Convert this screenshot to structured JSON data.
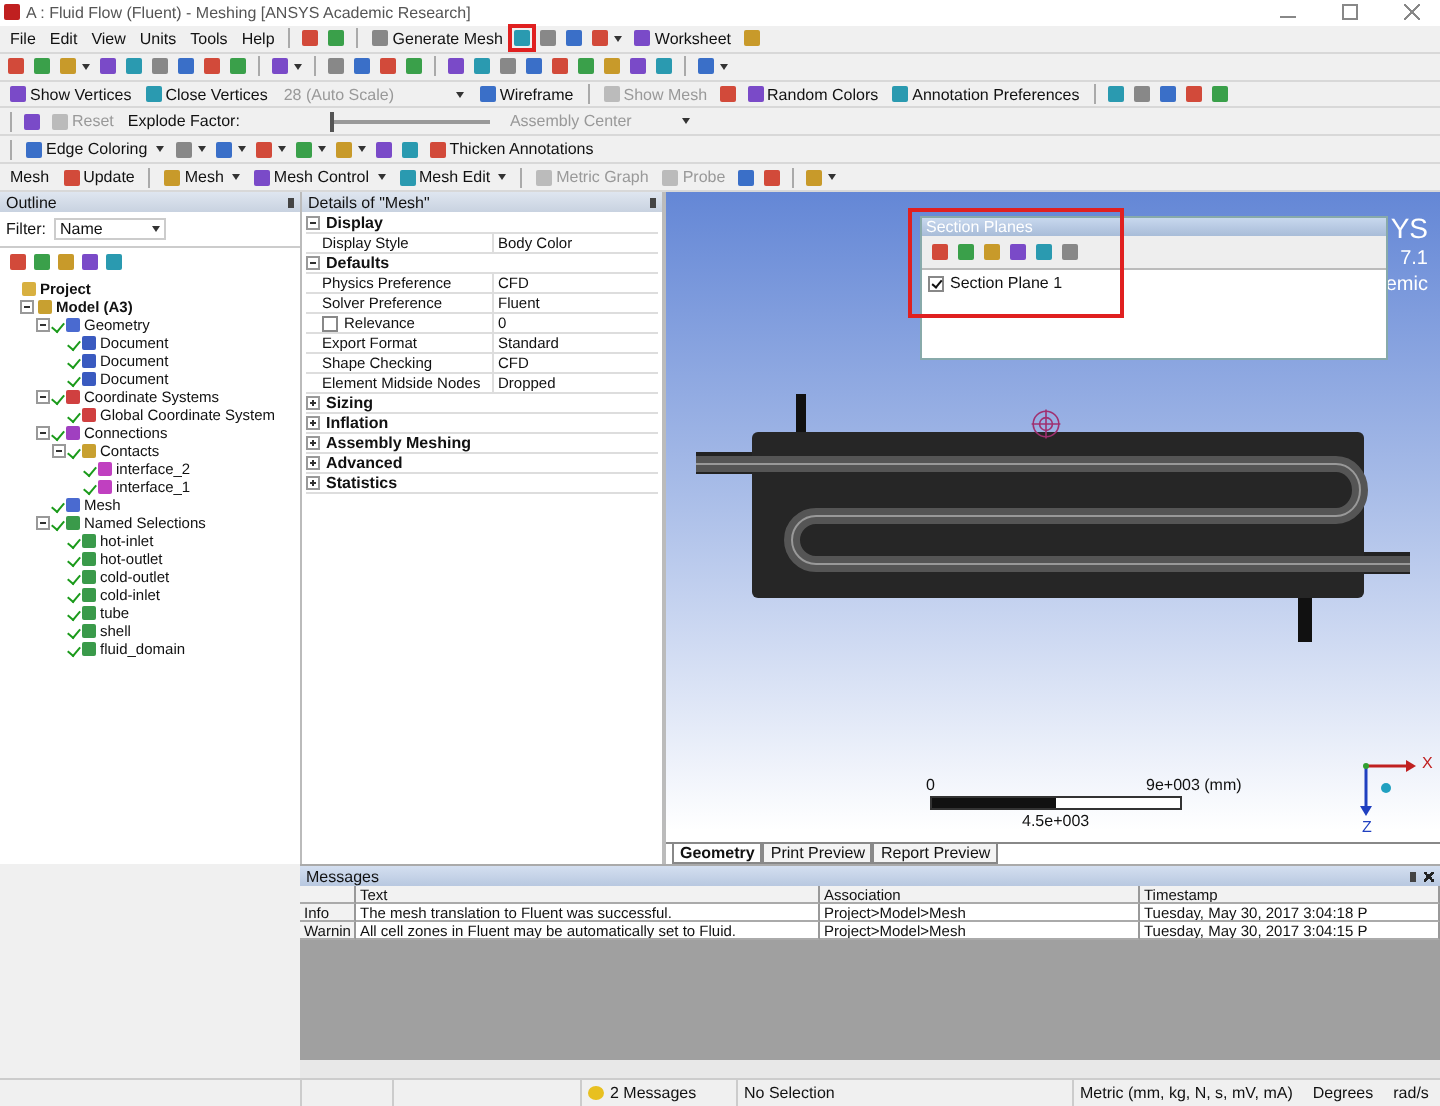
{
  "window": {
    "title": "A : Fluid Flow (Fluent) - Meshing [ANSYS Academic Research]"
  },
  "menu": [
    "File",
    "Edit",
    "View",
    "Units",
    "Tools",
    "Help"
  ],
  "toolbars": [
    {
      "items": [
        {
          "kind": "sep"
        },
        {
          "kind": "icon",
          "caret": false,
          "highlighted": false
        },
        {
          "kind": "icon",
          "caret": false,
          "highlighted": false
        },
        {
          "kind": "sep"
        },
        {
          "kind": "button",
          "label": "Generate Mesh",
          "caret": false,
          "disabled": false
        },
        {
          "kind": "icon",
          "caret": false,
          "highlighted": true
        },
        {
          "kind": "icon",
          "caret": false,
          "highlighted": false
        },
        {
          "kind": "icon",
          "caret": false,
          "highlighted": false
        },
        {
          "kind": "icon",
          "caret": true,
          "highlighted": false
        },
        {
          "kind": "button",
          "label": "Worksheet",
          "caret": false,
          "disabled": false
        },
        {
          "kind": "icon",
          "caret": false,
          "highlighted": false
        }
      ]
    },
    {
      "items": [
        {
          "kind": "icon",
          "caret": false,
          "highlighted": false
        },
        {
          "kind": "icon",
          "caret": false,
          "highlighted": false
        },
        {
          "kind": "icon",
          "caret": true,
          "highlighted": false
        },
        {
          "kind": "icon",
          "caret": false,
          "highlighted": false
        },
        {
          "kind": "icon",
          "caret": false,
          "highlighted": false
        },
        {
          "kind": "icon",
          "caret": false,
          "highlighted": false
        },
        {
          "kind": "icon",
          "caret": false,
          "highlighted": false
        },
        {
          "kind": "icon",
          "caret": false,
          "highlighted": false
        },
        {
          "kind": "icon",
          "caret": false,
          "highlighted": false
        },
        {
          "kind": "sep"
        },
        {
          "kind": "icon",
          "caret": true,
          "highlighted": false
        },
        {
          "kind": "sep"
        },
        {
          "kind": "icon",
          "caret": false,
          "highlighted": false
        },
        {
          "kind": "icon",
          "caret": false,
          "highlighted": false
        },
        {
          "kind": "icon",
          "caret": false,
          "highlighted": false
        },
        {
          "kind": "icon",
          "caret": false,
          "highlighted": false
        },
        {
          "kind": "sep"
        },
        {
          "kind": "icon",
          "caret": false,
          "highlighted": false
        },
        {
          "kind": "icon",
          "caret": false,
          "highlighted": false
        },
        {
          "kind": "icon",
          "caret": false,
          "highlighted": false
        },
        {
          "kind": "icon",
          "caret": false,
          "highlighted": false
        },
        {
          "kind": "icon",
          "caret": false,
          "highlighted": false
        },
        {
          "kind": "icon",
          "caret": false,
          "highlighted": false
        },
        {
          "kind": "icon",
          "caret": false,
          "highlighted": false
        },
        {
          "kind": "icon",
          "caret": false,
          "highlighted": false
        },
        {
          "kind": "icon",
          "caret": false,
          "highlighted": false
        },
        {
          "kind": "sep"
        },
        {
          "kind": "icon",
          "caret": true,
          "highlighted": false
        }
      ]
    },
    {
      "items": [
        {
          "kind": "button",
          "label": "Show Vertices",
          "caret": false,
          "disabled": false
        },
        {
          "kind": "button",
          "label": "Close Vertices",
          "caret": false,
          "disabled": false
        },
        {
          "kind": "dropdown",
          "value": "28 (Auto Scale)",
          "disabled": true
        },
        {
          "kind": "button",
          "label": "Wireframe",
          "caret": false,
          "disabled": false
        },
        {
          "kind": "sep"
        },
        {
          "kind": "button",
          "label": "Show Mesh",
          "caret": false,
          "disabled": true
        },
        {
          "kind": "icon",
          "caret": false,
          "highlighted": false
        },
        {
          "kind": "button",
          "label": "Random Colors",
          "caret": false,
          "disabled": false
        },
        {
          "kind": "button",
          "label": "Annotation Preferences",
          "caret": false,
          "disabled": false
        },
        {
          "kind": "sep"
        },
        {
          "kind": "icon",
          "caret": false,
          "highlighted": false
        },
        {
          "kind": "icon",
          "caret": false,
          "highlighted": false
        },
        {
          "kind": "icon",
          "caret": false,
          "highlighted": false
        },
        {
          "kind": "icon",
          "caret": false,
          "highlighted": false
        },
        {
          "kind": "icon",
          "caret": false,
          "highlighted": false
        }
      ]
    },
    {
      "items": [
        {
          "kind": "sep"
        },
        {
          "kind": "icon",
          "caret": false,
          "highlighted": false
        },
        {
          "kind": "button",
          "label": "Reset",
          "caret": false,
          "disabled": true
        },
        {
          "kind": "label",
          "text": "Explode Factor:"
        },
        {
          "kind": "slider",
          "level": 0
        },
        {
          "kind": "dropdown",
          "value": "Assembly Center",
          "disabled": true
        }
      ]
    },
    {
      "items": [
        {
          "kind": "sep"
        },
        {
          "kind": "button",
          "label": "Edge Coloring",
          "caret": true,
          "disabled": false
        },
        {
          "kind": "icon",
          "caret": true,
          "highlighted": false
        },
        {
          "kind": "icon",
          "caret": true,
          "highlighted": false
        },
        {
          "kind": "icon",
          "caret": true,
          "highlighted": false
        },
        {
          "kind": "icon",
          "caret": true,
          "highlighted": false
        },
        {
          "kind": "icon",
          "caret": true,
          "highlighted": false
        },
        {
          "kind": "icon",
          "caret": false,
          "highlighted": false
        },
        {
          "kind": "icon",
          "caret": false,
          "highlighted": false
        },
        {
          "kind": "button",
          "label": "Thicken Annotations",
          "caret": false,
          "disabled": false
        }
      ]
    },
    {
      "items": [
        {
          "kind": "label",
          "text": "Mesh"
        },
        {
          "kind": "button",
          "label": "Update",
          "caret": false,
          "disabled": false
        },
        {
          "kind": "sep"
        },
        {
          "kind": "button",
          "label": "Mesh",
          "caret": true,
          "disabled": false
        },
        {
          "kind": "button",
          "label": "Mesh Control",
          "caret": true,
          "disabled": false
        },
        {
          "kind": "button",
          "label": "Mesh Edit",
          "caret": true,
          "disabled": false
        },
        {
          "kind": "sep"
        },
        {
          "kind": "button",
          "label": "Metric Graph",
          "caret": false,
          "disabled": true
        },
        {
          "kind": "button",
          "label": "Probe",
          "caret": false,
          "disabled": true
        },
        {
          "kind": "icon",
          "caret": false,
          "highlighted": false
        },
        {
          "kind": "icon",
          "caret": false,
          "highlighted": false
        },
        {
          "kind": "sep"
        },
        {
          "kind": "icon",
          "caret": true,
          "highlighted": false
        }
      ]
    }
  ],
  "outline": {
    "title": "Outline",
    "filter_label": "Filter:",
    "filter_value": "Name",
    "tree": [
      {
        "label": "Project",
        "kind": "project",
        "children": [
          {
            "label": "Model (A3)",
            "kind": "model",
            "expanded": true,
            "children": [
              {
                "label": "Geometry",
                "kind": "geometry",
                "expanded": true,
                "children": [
                  {
                    "label": "Document",
                    "kind": "body"
                  },
                  {
                    "label": "Document",
                    "kind": "body"
                  },
                  {
                    "label": "Document",
                    "kind": "body"
                  }
                ]
              },
              {
                "label": "Coordinate Systems",
                "kind": "coords",
                "expanded": true,
                "children": [
                  {
                    "label": "Global Coordinate System",
                    "kind": "coords"
                  }
                ]
              },
              {
                "label": "Connections",
                "kind": "connections",
                "expanded": true,
                "children": [
                  {
                    "label": "Contacts",
                    "kind": "contacts",
                    "expanded": true,
                    "children": [
                      {
                        "label": "interface_2",
                        "kind": "contact"
                      },
                      {
                        "label": "interface_1",
                        "kind": "contact"
                      }
                    ]
                  }
                ]
              },
              {
                "label": "Mesh",
                "kind": "mesh"
              },
              {
                "label": "Named Selections",
                "kind": "named",
                "expanded": true,
                "children": [
                  {
                    "label": "hot-inlet",
                    "kind": "named"
                  },
                  {
                    "label": "hot-outlet",
                    "kind": "named"
                  },
                  {
                    "label": "cold-outlet",
                    "kind": "named"
                  },
                  {
                    "label": "cold-inlet",
                    "kind": "named"
                  },
                  {
                    "label": "tube",
                    "kind": "named"
                  },
                  {
                    "label": "shell",
                    "kind": "named"
                  },
                  {
                    "label": "fluid_domain",
                    "kind": "named"
                  }
                ]
              }
            ]
          }
        ]
      }
    ]
  },
  "details": {
    "title": "Details of \"Mesh\"",
    "groups": [
      {
        "name": "Display",
        "expanded": true,
        "rows": [
          {
            "label": "Display Style",
            "value": "Body Color"
          }
        ]
      },
      {
        "name": "Defaults",
        "expanded": true,
        "rows": [
          {
            "label": "Physics Preference",
            "value": "CFD"
          },
          {
            "label": "Solver Preference",
            "value": "Fluent"
          },
          {
            "label": "Relevance",
            "value": "0",
            "checked": false
          },
          {
            "label": "Export Format",
            "value": "Standard"
          },
          {
            "label": "Shape Checking",
            "value": "CFD"
          },
          {
            "label": "Element Midside Nodes",
            "value": "Dropped"
          }
        ]
      },
      {
        "name": "Sizing",
        "expanded": false
      },
      {
        "name": "Inflation",
        "expanded": false
      },
      {
        "name": "Assembly Meshing",
        "expanded": false
      },
      {
        "name": "Advanced",
        "expanded": false
      },
      {
        "name": "Statistics",
        "expanded": false
      }
    ]
  },
  "viewport": {
    "logo": [
      "YS",
      "7.1",
      "emic"
    ],
    "section_planes": {
      "title": "Section Planes",
      "highlighted": true,
      "items": [
        {
          "label": "Section Plane 1",
          "checked": true
        }
      ]
    },
    "scale": {
      "start": "0",
      "end": "9e+003 (mm)",
      "mid": "4.5e+003"
    },
    "axes": {
      "x": "X",
      "z": "Z"
    },
    "tabs": [
      {
        "label": "Geometry",
        "selected": true
      },
      {
        "label": "Print Preview",
        "selected": false
      },
      {
        "label": "Report Preview",
        "selected": false
      }
    ]
  },
  "messages": {
    "title": "Messages",
    "columns": [
      "Text",
      "Association",
      "Timestamp"
    ],
    "rows": [
      {
        "type": "Info",
        "text": "The mesh translation to Fluent was successful.",
        "association": "Project>Model>Mesh",
        "timestamp": "Tuesday, May 30, 2017 3:04:18 P"
      },
      {
        "type": "Warnin",
        "text": "All cell zones in Fluent may be automatically set to Fluid.",
        "association": "Project>Model>Mesh",
        "timestamp": "Tuesday, May 30, 2017 3:04:15 P"
      }
    ]
  },
  "status_bar": {
    "messages": "2 Messages",
    "selection": "No Selection",
    "units": "Metric (mm, kg, N, s, mV, mA)",
    "angle": "Degrees",
    "rate": "rad/s"
  }
}
